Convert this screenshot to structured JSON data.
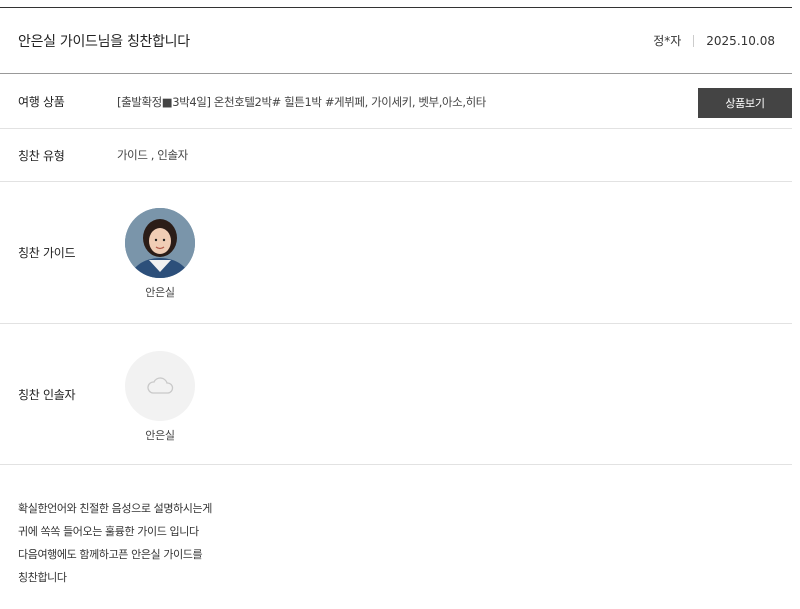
{
  "header": {
    "title": "안은실 가이드님을 칭찬합니다",
    "author": "정*자",
    "date": "2025.10.08"
  },
  "product": {
    "label": "여행 상품",
    "value": "[출발확정■3박4일] 온천호텔2박# 힐튼1박 #게뷔페, 가이세키, 벳부,아소,히타",
    "button_label": "상품보기"
  },
  "praise_type": {
    "label": "칭찬 유형",
    "value": "가이드 , 인솔자"
  },
  "praise_guide": {
    "label": "칭찬 가이드",
    "name": "안은실",
    "avatar_icon": "person-photo-icon"
  },
  "praise_escort": {
    "label": "칭찬 인솔자",
    "name": "안은실",
    "avatar_icon": "cloud-placeholder-icon"
  },
  "message": {
    "lines": [
      "확실한언어와 친절한 음성으로 설명하시는게",
      "귀에 쏙쏙 들어오는 훌륭한 가이드 입니다",
      "다음여행에도 함께하고픈 안은실 가이드를",
      "칭찬합니다"
    ]
  },
  "colors": {
    "button_bg": "#444444",
    "border_dark": "#333333",
    "border_light": "#e2e2e2"
  }
}
